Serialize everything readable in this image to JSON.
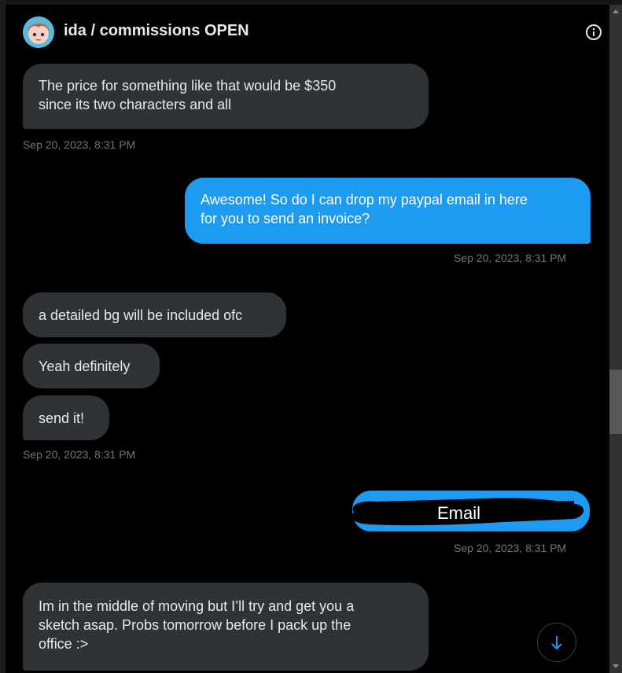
{
  "header": {
    "title": "ida / commissions OPEN",
    "avatar_alt": "avatar",
    "info_icon": "info-icon"
  },
  "messages": [
    {
      "direction": "in",
      "text": "The price for something like that would be $350\nsince its two characters and all"
    },
    {
      "direction": "out",
      "text": "Awesome! So do I can drop my paypal email in here\nfor you to send an invoice?"
    },
    {
      "direction": "in",
      "text": "a detailed bg will be included ofc"
    },
    {
      "direction": "in",
      "text": "Yeah definitely"
    },
    {
      "direction": "in",
      "text": "send it!"
    },
    {
      "direction": "out",
      "text": "Email"
    },
    {
      "direction": "in",
      "text": "Im in the middle of moving but I’ll try and get you a\nsketch asap. Probs tomorrow before I pack up the\noffice :>"
    }
  ],
  "timestamps": [
    "Sep 20, 2023, 8:31 PM",
    "Sep 20, 2023, 8:31 PM",
    "Sep 20, 2023, 8:31 PM",
    "Sep 20, 2023, 8:31 PM"
  ],
  "colors": {
    "incoming_bubble": "#2f3336",
    "outgoing_bubble": "#1d9bf0",
    "timestamp": "#71767b",
    "background": "#000000"
  },
  "scroll_down_icon": "arrow-down-icon"
}
